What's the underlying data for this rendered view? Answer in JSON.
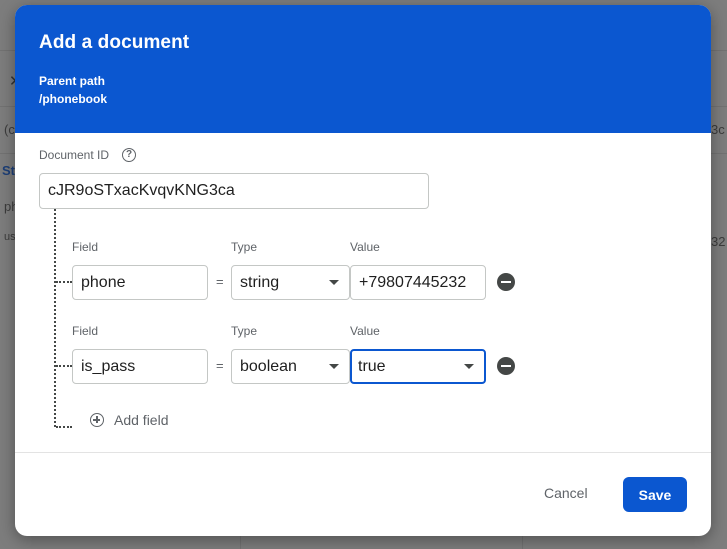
{
  "background": {
    "fragments": [
      "St",
      "ph",
      "us",
      "(c",
      "3c",
      "32"
    ]
  },
  "dialog": {
    "title": "Add a document",
    "parent_path_label": "Parent path",
    "parent_path_value": "/phonebook",
    "document_id_label": "Document ID",
    "document_id_value": "cJR9oSTxacKvqvKNG3ca",
    "fields": [
      {
        "field_label": "Field",
        "type_label": "Type",
        "value_label": "Value",
        "field": "phone",
        "type": "string",
        "value": "+79807445232"
      },
      {
        "field_label": "Field",
        "type_label": "Type",
        "value_label": "Value",
        "field": "is_pass",
        "type": "boolean",
        "value": "true"
      }
    ],
    "equals_sign": "=",
    "add_field_label": "Add field",
    "cancel_label": "Cancel",
    "save_label": "Save"
  },
  "colors": {
    "header": "#0b57d0",
    "primary": "#0b57d0",
    "overlay": "#7f7f7f"
  },
  "icons": [
    "help-icon",
    "remove-icon",
    "add-circle-icon",
    "dropdown-caret-icon",
    "close-icon"
  ]
}
